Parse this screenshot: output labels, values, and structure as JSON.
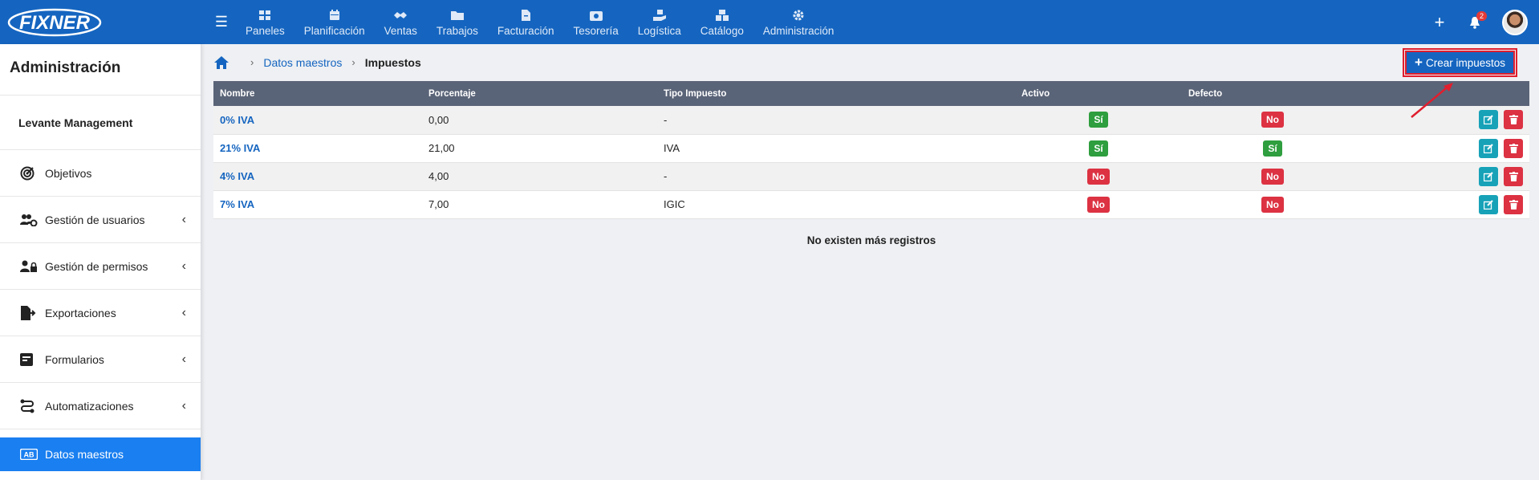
{
  "brand": {
    "logo_text": "FIXNER"
  },
  "topnav": {
    "items": [
      {
        "label": "Paneles",
        "icon": "dashboard-icon"
      },
      {
        "label": "Planificación",
        "icon": "calendar-icon"
      },
      {
        "label": "Ventas",
        "icon": "handshake-icon"
      },
      {
        "label": "Trabajos",
        "icon": "folder-icon"
      },
      {
        "label": "Facturación",
        "icon": "invoice-icon"
      },
      {
        "label": "Tesorería",
        "icon": "wallet-icon"
      },
      {
        "label": "Logística",
        "icon": "hand-box-icon"
      },
      {
        "label": "Catálogo",
        "icon": "boxes-icon"
      },
      {
        "label": "Administración",
        "icon": "gear-icon"
      }
    ],
    "notifications_count": "2"
  },
  "sidebar": {
    "title": "Administración",
    "company": "Levante Management",
    "items": [
      {
        "label": "Objetivos",
        "icon": "target-icon",
        "expandable": false
      },
      {
        "label": "Gestión de usuarios",
        "icon": "users-gear-icon",
        "expandable": true
      },
      {
        "label": "Gestión de permisos",
        "icon": "user-lock-icon",
        "expandable": true
      },
      {
        "label": "Exportaciones",
        "icon": "file-export-icon",
        "expandable": true
      },
      {
        "label": "Formularios",
        "icon": "form-icon",
        "expandable": true
      },
      {
        "label": "Automatizaciones",
        "icon": "route-icon",
        "expandable": true
      },
      {
        "label": "Datos maestros",
        "icon": "ab-card-icon",
        "active": true
      }
    ]
  },
  "breadcrumb": {
    "parent": "Datos maestros",
    "current": "Impuestos"
  },
  "actions": {
    "create_label": "Crear impuestos"
  },
  "table": {
    "columns": [
      "Nombre",
      "Porcentaje",
      "Tipo Impuesto",
      "Activo",
      "Defecto"
    ],
    "rows": [
      {
        "nombre": "0% IVA",
        "porcentaje": "0,00",
        "tipo": "-",
        "activo": "Sí",
        "defecto": "No"
      },
      {
        "nombre": "21% IVA",
        "porcentaje": "21,00",
        "tipo": "IVA",
        "activo": "Sí",
        "defecto": "Sí"
      },
      {
        "nombre": "4% IVA",
        "porcentaje": "4,00",
        "tipo": "-",
        "activo": "No",
        "defecto": "No"
      },
      {
        "nombre": "7% IVA",
        "porcentaje": "7,00",
        "tipo": "IGIC",
        "activo": "No",
        "defecto": "No"
      }
    ],
    "footer": "No existen más registros"
  },
  "colors": {
    "primary": "#1565c0",
    "header_bg": "#5a6478",
    "yes": "#2e9e3e",
    "no": "#dc3242",
    "highlight": "#e01e2e"
  }
}
